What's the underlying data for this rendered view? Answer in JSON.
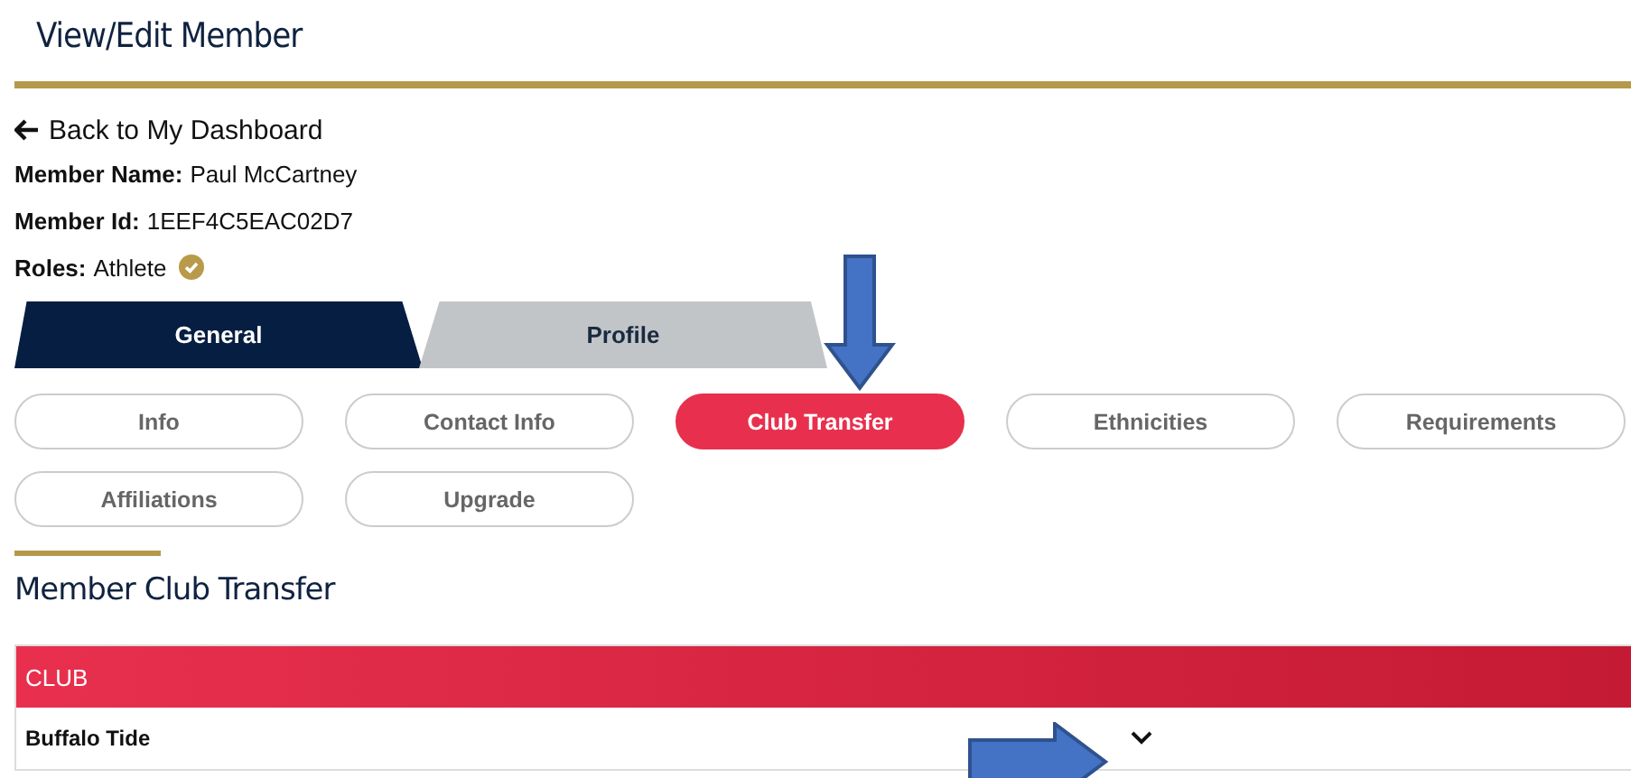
{
  "page_title": "View/Edit Member",
  "back_link": {
    "label": "Back to My Dashboard"
  },
  "member_info": [
    {
      "label": "Member Name:",
      "value": "Paul McCartney"
    },
    {
      "label": "Member Id:",
      "value": "1EEF4C5EAC02D7"
    },
    {
      "label": "Roles:",
      "value": "Athlete",
      "verified": true
    }
  ],
  "tabs": [
    {
      "label": "General",
      "selected": true
    },
    {
      "label": "Profile",
      "selected": false
    }
  ],
  "subtabs": [
    {
      "label": "Info",
      "selected": false
    },
    {
      "label": "Contact Info",
      "selected": false
    },
    {
      "label": "Club Transfer",
      "selected": true
    },
    {
      "label": "Ethnicities",
      "selected": false
    },
    {
      "label": "Requirements",
      "selected": false
    },
    {
      "label": "Affiliations",
      "selected": false
    },
    {
      "label": "Upgrade",
      "selected": false
    }
  ],
  "section_title": "Member Club Transfer",
  "table": {
    "columns": [
      "CLUB"
    ],
    "rows": [
      {
        "club": "Buffalo Tide",
        "expanded": false
      }
    ]
  }
}
